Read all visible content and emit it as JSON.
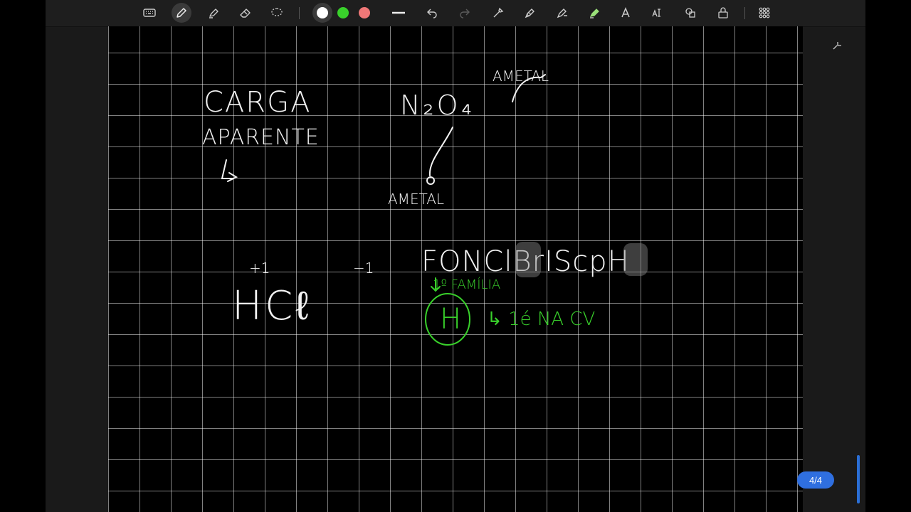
{
  "toolbar": {
    "tools": [
      {
        "icon": "keyboard-icon"
      },
      {
        "icon": "pen-icon",
        "active": true
      },
      {
        "icon": "highlighter-icon"
      },
      {
        "icon": "eraser-icon"
      },
      {
        "icon": "lasso-icon"
      }
    ],
    "colors": [
      "#ffffff",
      "#39d12b",
      "#f07878"
    ],
    "selected_color": "#ffffff"
  },
  "page": {
    "indicator": "4/4"
  },
  "notes": {
    "carga": "CARGA",
    "aparente": "APARENTE",
    "n2o4": "N₂O₄",
    "ametal_top": "AMETAL",
    "ametal_bottom": "AMETAL",
    "hcl": "HCℓ",
    "charge_pos": "+1",
    "charge_neg": "−1",
    "fonclbrscph": "FONClBrIScpH",
    "familia": "1º FAMÍLIA",
    "h": "H",
    "ena_cv": "↳ 1é NA CV"
  }
}
